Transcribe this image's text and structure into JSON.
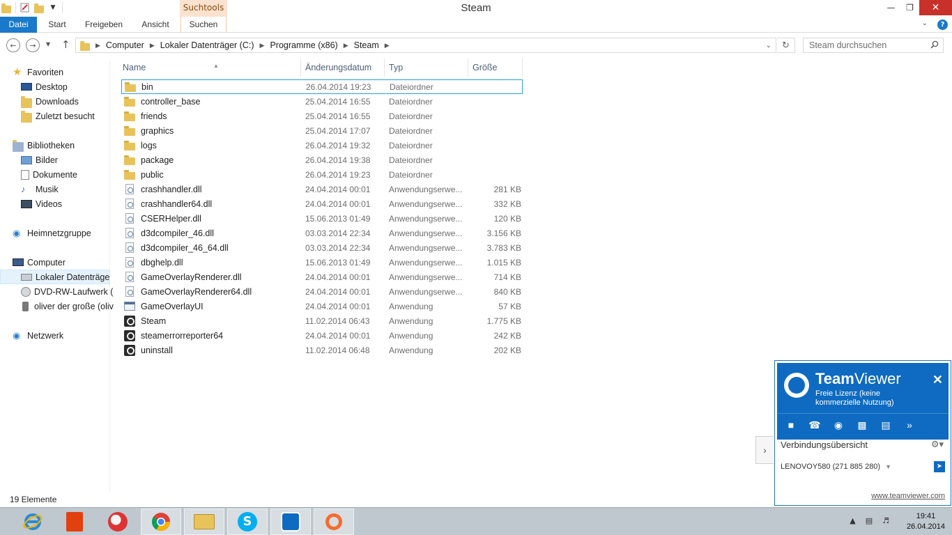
{
  "window": {
    "title": "Steam",
    "context_tab_label": "Suchtools",
    "minimize_label": "—",
    "restore_label": "❐",
    "close_label": "✕"
  },
  "ribbon": {
    "tabs": [
      "Datei",
      "Start",
      "Freigeben",
      "Ansicht",
      "Suchen"
    ]
  },
  "address": {
    "crumbs": [
      "Computer",
      "Lokaler Datenträger (C:)",
      "Programme (x86)",
      "Steam"
    ],
    "search_placeholder": "Steam durchsuchen"
  },
  "nav": {
    "favorites_header": "Favoriten",
    "favorites": [
      "Desktop",
      "Downloads",
      "Zuletzt besucht"
    ],
    "libraries_header": "Bibliotheken",
    "libraries": [
      "Bilder",
      "Dokumente",
      "Musik",
      "Videos"
    ],
    "homegroup": "Heimnetzgruppe",
    "computer_header": "Computer",
    "computer_items": [
      "Lokaler Datenträger",
      "DVD-RW-Laufwerk (",
      "oliver der große (oliv"
    ],
    "network": "Netzwerk"
  },
  "columns": {
    "name": "Name",
    "date": "Änderungsdatum",
    "type": "Typ",
    "size": "Größe"
  },
  "files": [
    {
      "name": "bin",
      "date": "26.04.2014 19:23",
      "type": "Dateiordner",
      "size": "",
      "icon": "folder",
      "selected": true
    },
    {
      "name": "controller_base",
      "date": "25.04.2014 16:55",
      "type": "Dateiordner",
      "size": "",
      "icon": "folder"
    },
    {
      "name": "friends",
      "date": "25.04.2014 16:55",
      "type": "Dateiordner",
      "size": "",
      "icon": "folder"
    },
    {
      "name": "graphics",
      "date": "25.04.2014 17:07",
      "type": "Dateiordner",
      "size": "",
      "icon": "folder"
    },
    {
      "name": "logs",
      "date": "26.04.2014 19:32",
      "type": "Dateiordner",
      "size": "",
      "icon": "folder"
    },
    {
      "name": "package",
      "date": "26.04.2014 19:38",
      "type": "Dateiordner",
      "size": "",
      "icon": "folder"
    },
    {
      "name": "public",
      "date": "26.04.2014 19:23",
      "type": "Dateiordner",
      "size": "",
      "icon": "folder"
    },
    {
      "name": "crashhandler.dll",
      "date": "24.04.2014 00:01",
      "type": "Anwendungserwe...",
      "size": "281 KB",
      "icon": "dll"
    },
    {
      "name": "crashhandler64.dll",
      "date": "24.04.2014 00:01",
      "type": "Anwendungserwe...",
      "size": "332 KB",
      "icon": "dll"
    },
    {
      "name": "CSERHelper.dll",
      "date": "15.06.2013 01:49",
      "type": "Anwendungserwe...",
      "size": "120 KB",
      "icon": "dll"
    },
    {
      "name": "d3dcompiler_46.dll",
      "date": "03.03.2014 22:34",
      "type": "Anwendungserwe...",
      "size": "3.156 KB",
      "icon": "dll"
    },
    {
      "name": "d3dcompiler_46_64.dll",
      "date": "03.03.2014 22:34",
      "type": "Anwendungserwe...",
      "size": "3.783 KB",
      "icon": "dll"
    },
    {
      "name": "dbghelp.dll",
      "date": "15.06.2013 01:49",
      "type": "Anwendungserwe...",
      "size": "1.015 KB",
      "icon": "dll"
    },
    {
      "name": "GameOverlayRenderer.dll",
      "date": "24.04.2014 00:01",
      "type": "Anwendungserwe...",
      "size": "714 KB",
      "icon": "dll"
    },
    {
      "name": "GameOverlayRenderer64.dll",
      "date": "24.04.2014 00:01",
      "type": "Anwendungserwe...",
      "size": "840 KB",
      "icon": "dll"
    },
    {
      "name": "GameOverlayUI",
      "date": "24.04.2014 00:01",
      "type": "Anwendung",
      "size": "57 KB",
      "icon": "app"
    },
    {
      "name": "Steam",
      "date": "11.02.2014 06:43",
      "type": "Anwendung",
      "size": "1.775 KB",
      "icon": "steam"
    },
    {
      "name": "steamerrorreporter64",
      "date": "24.04.2014 00:01",
      "type": "Anwendung",
      "size": "242 KB",
      "icon": "steam"
    },
    {
      "name": "uninstall",
      "date": "11.02.2014 06:48",
      "type": "Anwendung",
      "size": "202 KB",
      "icon": "steam"
    }
  ],
  "status": {
    "count_label": "19 Elemente"
  },
  "teamviewer": {
    "brand_bold": "Team",
    "brand_rest": "Viewer",
    "license": "Freie Lizenz (keine kommerzielle Nutzung)",
    "overview": "Verbindungsübersicht",
    "partner": "LENOVOY580 (271 885 280)",
    "link": "www.teamviewer.com"
  },
  "taskbar": {
    "apps": [
      "internet-explorer",
      "office",
      "paint",
      "chrome",
      "file-explorer",
      "skype",
      "teamviewer",
      "origin"
    ],
    "time": "19:41",
    "date": "26.04.2014"
  },
  "colors": {
    "accent": "#1979ca",
    "teamviewer_blue": "#0e6bc1",
    "context_tab": "#fbe2cf",
    "close_red": "#c7312a"
  }
}
